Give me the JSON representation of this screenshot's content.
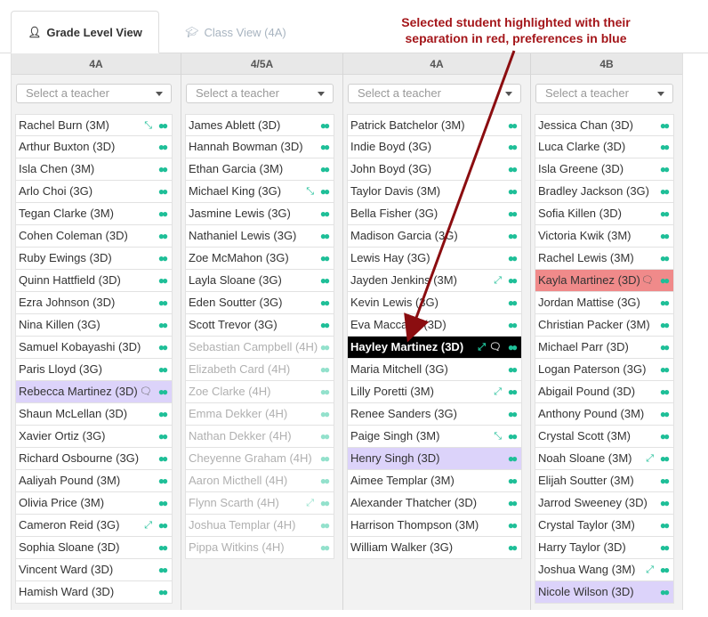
{
  "tabs": [
    {
      "label": "Grade Level View",
      "icon": "user-icon"
    },
    {
      "label": "Class View (4A)",
      "icon": "graduation-cap-icon"
    }
  ],
  "annotation": {
    "line1": "Selected student highlighted with their",
    "line2": "separation in red, preferences in blue"
  },
  "select_placeholder": "Select a teacher",
  "colors": {
    "accent_teal": "#1fbf98",
    "highlight_purple": "#dcd3fa",
    "highlight_red": "#f08a8a",
    "annotation_red": "#a4161a",
    "selected_black": "#000000"
  },
  "columns": [
    {
      "title": "4A",
      "students": [
        {
          "name": "Rachel Burn (3M)",
          "icons": [
            "compress-icon",
            "group-icon"
          ]
        },
        {
          "name": "Arthur Buxton (3D)",
          "icons": [
            "group-icon"
          ]
        },
        {
          "name": "Isla Chen (3M)",
          "icons": [
            "group-icon"
          ]
        },
        {
          "name": "Arlo Choi (3G)",
          "icons": [
            "group-icon"
          ]
        },
        {
          "name": "Tegan Clarke (3M)",
          "icons": [
            "group-icon"
          ]
        },
        {
          "name": "Cohen Coleman (3D)",
          "icons": [
            "group-icon"
          ]
        },
        {
          "name": "Ruby Ewings (3D)",
          "icons": [
            "group-icon"
          ]
        },
        {
          "name": "Quinn Hattfield (3D)",
          "icons": [
            "group-icon"
          ]
        },
        {
          "name": "Ezra Johnson (3D)",
          "icons": [
            "group-icon"
          ]
        },
        {
          "name": "Nina Killen (3G)",
          "icons": [
            "group-icon"
          ]
        },
        {
          "name": "Samuel Kobayashi (3D)",
          "icons": [
            "group-icon"
          ]
        },
        {
          "name": "Paris Lloyd (3G)",
          "icons": [
            "group-icon"
          ]
        },
        {
          "name": "Rebecca Martinez (3D)",
          "icons": [
            "comment-icon",
            "group-icon"
          ],
          "state": "purple"
        },
        {
          "name": "Shaun McLellan (3D)",
          "icons": [
            "group-icon"
          ]
        },
        {
          "name": "Xavier Ortiz (3G)",
          "icons": [
            "group-icon"
          ]
        },
        {
          "name": "Richard Osbourne (3G)",
          "icons": [
            "group-icon"
          ]
        },
        {
          "name": "Aaliyah Pound (3M)",
          "icons": [
            "group-icon"
          ]
        },
        {
          "name": "Olivia Price (3M)",
          "icons": [
            "group-icon"
          ]
        },
        {
          "name": "Cameron Reid (3G)",
          "icons": [
            "expand-icon",
            "group-icon"
          ]
        },
        {
          "name": "Sophia Sloane (3D)",
          "icons": [
            "group-icon"
          ]
        },
        {
          "name": "Vincent Ward (3D)",
          "icons": [
            "group-icon"
          ]
        },
        {
          "name": "Hamish Ward (3D)",
          "icons": [
            "group-icon"
          ]
        }
      ]
    },
    {
      "title": "4/5A",
      "students": [
        {
          "name": "James Ablett (3D)",
          "icons": [
            "group-icon"
          ]
        },
        {
          "name": "Hannah Bowman (3D)",
          "icons": [
            "group-icon"
          ]
        },
        {
          "name": "Ethan Garcia (3M)",
          "icons": [
            "group-icon"
          ]
        },
        {
          "name": "Michael King (3G)",
          "icons": [
            "compress-icon",
            "group-icon"
          ]
        },
        {
          "name": "Jasmine Lewis (3G)",
          "icons": [
            "group-icon"
          ]
        },
        {
          "name": "Nathaniel Lewis (3G)",
          "icons": [
            "group-icon"
          ]
        },
        {
          "name": "Zoe McMahon (3G)",
          "icons": [
            "group-icon"
          ]
        },
        {
          "name": "Layla Sloane (3G)",
          "icons": [
            "group-icon"
          ]
        },
        {
          "name": "Eden Soutter (3G)",
          "icons": [
            "group-icon"
          ]
        },
        {
          "name": "Scott Trevor (3G)",
          "icons": [
            "group-icon"
          ]
        },
        {
          "name": "Sebastian Campbell (4H)",
          "icons": [
            "group-icon"
          ],
          "state": "disabled"
        },
        {
          "name": "Elizabeth Card (4H)",
          "icons": [
            "group-icon"
          ],
          "state": "disabled"
        },
        {
          "name": "Zoe Clarke (4H)",
          "icons": [
            "group-icon"
          ],
          "state": "disabled"
        },
        {
          "name": "Emma Dekker (4H)",
          "icons": [
            "group-icon"
          ],
          "state": "disabled"
        },
        {
          "name": "Nathan Dekker (4H)",
          "icons": [
            "group-icon"
          ],
          "state": "disabled"
        },
        {
          "name": "Cheyenne Graham (4H)",
          "icons": [
            "group-icon"
          ],
          "state": "disabled"
        },
        {
          "name": "Aaron Micthell (4H)",
          "icons": [
            "group-icon"
          ],
          "state": "disabled"
        },
        {
          "name": "Flynn Scarth (4H)",
          "icons": [
            "expand-icon",
            "group-icon"
          ],
          "state": "disabled"
        },
        {
          "name": "Joshua Templar (4H)",
          "icons": [
            "group-icon"
          ],
          "state": "disabled"
        },
        {
          "name": "Pippa Witkins (4H)",
          "icons": [
            "group-icon"
          ],
          "state": "disabled"
        }
      ]
    },
    {
      "title": "4A",
      "students": [
        {
          "name": "Patrick Batchelor (3M)",
          "icons": [
            "group-icon"
          ]
        },
        {
          "name": "Indie Boyd (3G)",
          "icons": [
            "group-icon"
          ]
        },
        {
          "name": "John Boyd (3G)",
          "icons": [
            "group-icon"
          ]
        },
        {
          "name": "Taylor Davis (3M)",
          "icons": [
            "group-icon"
          ]
        },
        {
          "name": "Bella Fisher (3G)",
          "icons": [
            "group-icon"
          ]
        },
        {
          "name": "Madison Garcia (3G)",
          "icons": [
            "group-icon"
          ]
        },
        {
          "name": "Lewis Hay (3G)",
          "icons": [
            "group-icon"
          ]
        },
        {
          "name": "Jayden Jenkins (3M)",
          "icons": [
            "expand-icon",
            "group-icon"
          ]
        },
        {
          "name": "Kevin Lewis (3G)",
          "icons": [
            "group-icon"
          ]
        },
        {
          "name": "Eva Maccabe (3D)",
          "icons": [
            "group-icon"
          ]
        },
        {
          "name": "Hayley Martinez (3D)",
          "icons": [
            "expand-icon",
            "comment-icon",
            "group-icon"
          ],
          "state": "black"
        },
        {
          "name": "Maria Mitchell (3G)",
          "icons": [
            "group-icon"
          ]
        },
        {
          "name": "Lilly Poretti (3M)",
          "icons": [
            "expand-icon",
            "group-icon"
          ]
        },
        {
          "name": "Renee Sanders (3G)",
          "icons": [
            "group-icon"
          ]
        },
        {
          "name": "Paige Singh (3M)",
          "icons": [
            "compress-icon",
            "group-icon"
          ]
        },
        {
          "name": "Henry Singh (3D)",
          "icons": [
            "group-icon"
          ],
          "state": "purple"
        },
        {
          "name": "Aimee Templar (3M)",
          "icons": [
            "group-icon"
          ]
        },
        {
          "name": "Alexander Thatcher (3D)",
          "icons": [
            "group-icon"
          ]
        },
        {
          "name": "Harrison Thompson (3M)",
          "icons": [
            "group-icon"
          ]
        },
        {
          "name": "William Walker (3G)",
          "icons": [
            "group-icon"
          ]
        }
      ]
    },
    {
      "title": "4B",
      "students": [
        {
          "name": "Jessica Chan (3D)",
          "icons": [
            "group-icon"
          ]
        },
        {
          "name": "Luca Clarke (3D)",
          "icons": [
            "group-icon"
          ]
        },
        {
          "name": "Isla Greene (3D)",
          "icons": [
            "group-icon"
          ]
        },
        {
          "name": "Bradley Jackson (3G)",
          "icons": [
            "group-icon"
          ]
        },
        {
          "name": "Sofia Killen (3D)",
          "icons": [
            "group-icon"
          ]
        },
        {
          "name": "Victoria Kwik (3M)",
          "icons": [
            "group-icon"
          ]
        },
        {
          "name": "Rachel Lewis (3M)",
          "icons": [
            "group-icon"
          ]
        },
        {
          "name": "Kayla Martinez (3D)",
          "icons": [
            "comment-icon",
            "group-icon"
          ],
          "state": "red"
        },
        {
          "name": "Jordan Mattise (3G)",
          "icons": [
            "group-icon"
          ]
        },
        {
          "name": "Christian Packer (3M)",
          "icons": [
            "group-icon"
          ]
        },
        {
          "name": "Michael Parr (3D)",
          "icons": [
            "group-icon"
          ]
        },
        {
          "name": "Logan Paterson (3G)",
          "icons": [
            "group-icon"
          ]
        },
        {
          "name": "Abigail Pound (3D)",
          "icons": [
            "group-icon"
          ]
        },
        {
          "name": "Anthony Pound (3M)",
          "icons": [
            "group-icon"
          ]
        },
        {
          "name": "Crystal Scott (3M)",
          "icons": [
            "group-icon"
          ]
        },
        {
          "name": "Noah Sloane (3M)",
          "icons": [
            "expand-icon",
            "group-icon"
          ]
        },
        {
          "name": "Elijah Soutter (3M)",
          "icons": [
            "group-icon"
          ]
        },
        {
          "name": "Jarrod Sweeney (3D)",
          "icons": [
            "group-icon"
          ]
        },
        {
          "name": "Crystal Taylor (3M)",
          "icons": [
            "group-icon"
          ]
        },
        {
          "name": "Harry Taylor (3D)",
          "icons": [
            "group-icon"
          ]
        },
        {
          "name": "Joshua Wang (3M)",
          "icons": [
            "expand-icon",
            "group-icon"
          ]
        },
        {
          "name": "Nicole Wilson (3D)",
          "icons": [
            "group-icon"
          ],
          "state": "purple"
        }
      ]
    }
  ]
}
